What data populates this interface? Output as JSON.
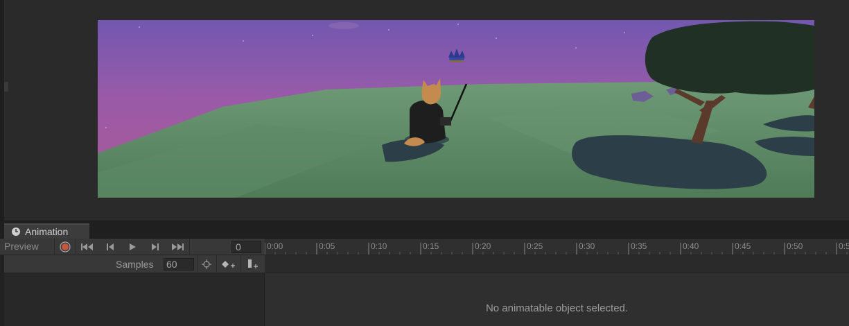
{
  "animation_tab": {
    "label": "Animation",
    "icon": "clock-icon"
  },
  "controls": {
    "preview_label": "Preview",
    "record_icon": "record-icon",
    "first_key_icon": "first-keyframe-icon",
    "prev_key_icon": "previous-keyframe-icon",
    "play_icon": "play-icon",
    "next_key_icon": "next-keyframe-icon",
    "last_key_icon": "last-keyframe-icon",
    "frame_value": "0"
  },
  "samples": {
    "label": "Samples",
    "value": "60",
    "filter_icon": "filter-by-selection-icon",
    "add_keyframe_icon": "add-keyframe-icon",
    "add_event_icon": "add-event-icon"
  },
  "timeline": {
    "labels": [
      "0:00",
      "0:05",
      "0:10",
      "0:15",
      "0:20",
      "0:25",
      "0:30",
      "0:35",
      "0:40",
      "0:45",
      "0:50",
      "0:5"
    ]
  },
  "dopesheet": {
    "message": "No animatable object selected."
  },
  "colors": {
    "record_red": "#c6573d",
    "panel_bg": "#282828",
    "toolbar_bg": "#383838"
  }
}
